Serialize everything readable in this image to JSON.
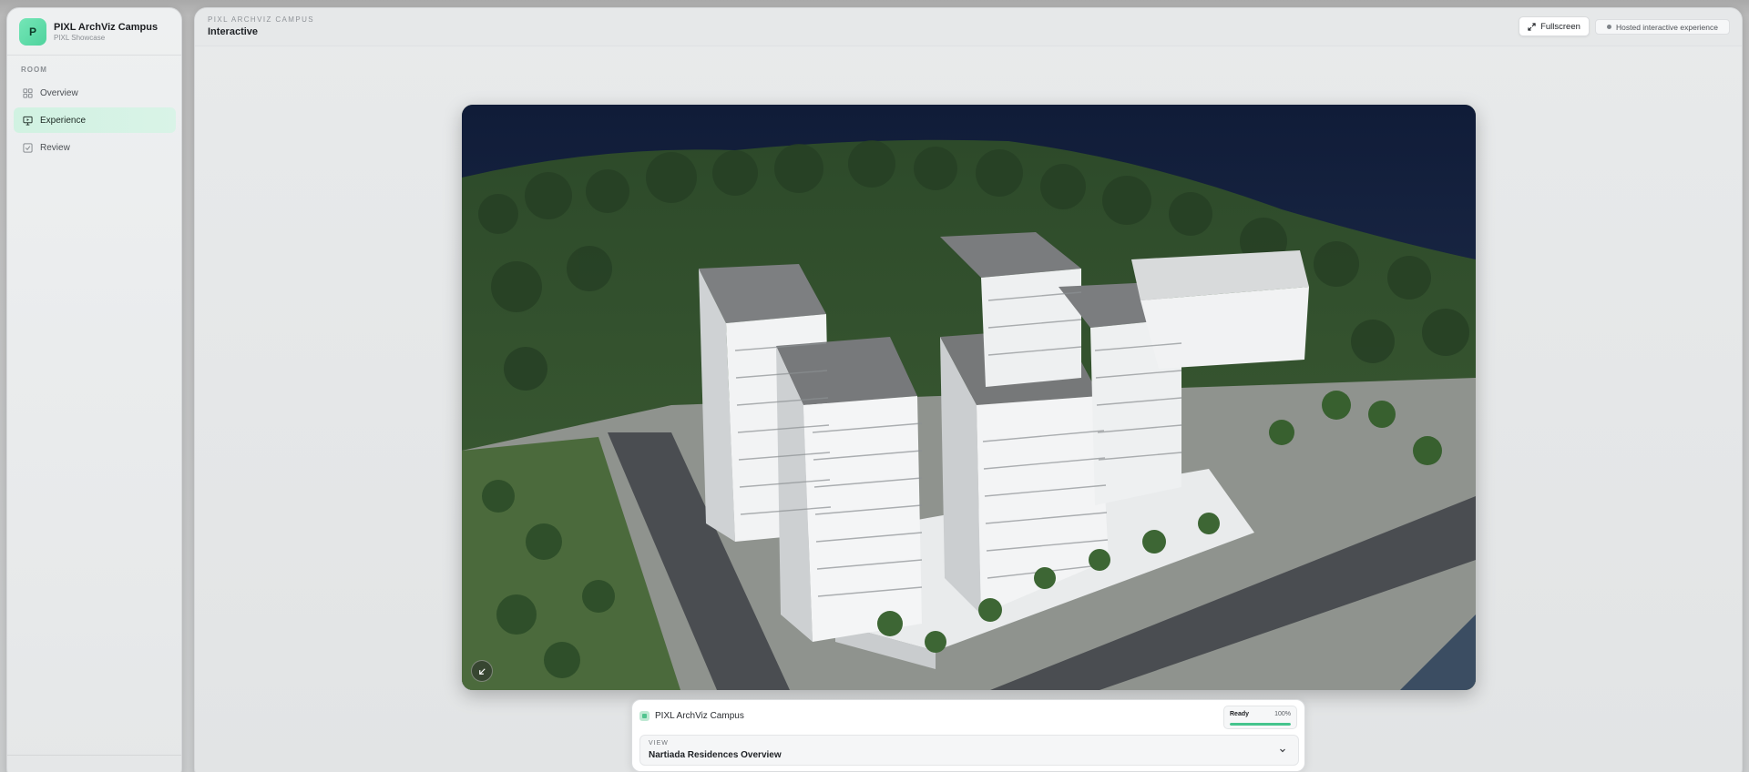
{
  "sidebar": {
    "brand": {
      "logo_letter": "P",
      "title": "PIXL ArchViz Campus",
      "subtitle": "PIXL Showcase"
    },
    "section_label": "ROOM",
    "items": [
      {
        "label": "Overview",
        "icon": "grid-icon",
        "active": false
      },
      {
        "label": "Experience",
        "icon": "monitor-icon",
        "active": true
      },
      {
        "label": "Review",
        "icon": "checkbox-icon",
        "active": false
      }
    ]
  },
  "header": {
    "eyebrow": "PIXL ARCHVIZ CAMPUS",
    "title": "Interactive",
    "fullscreen_label": "Fullscreen",
    "hosted_badge": "Hosted interactive experience"
  },
  "viewport": {
    "scene": "3d-architecture-render",
    "corner_button_icon": "collapse-arrow-icon"
  },
  "card": {
    "app_name": "PIXL ArchViz Campus",
    "status": {
      "label": "Ready",
      "percent_text": "100%",
      "progress": 1.0
    },
    "view": {
      "label": "VIEW",
      "value": "Nartiada Residences Overview"
    }
  },
  "colors": {
    "accent": "#45c48d",
    "active_nav_bg": "#d1f2e2",
    "brand_logo": "#5cdba6"
  }
}
